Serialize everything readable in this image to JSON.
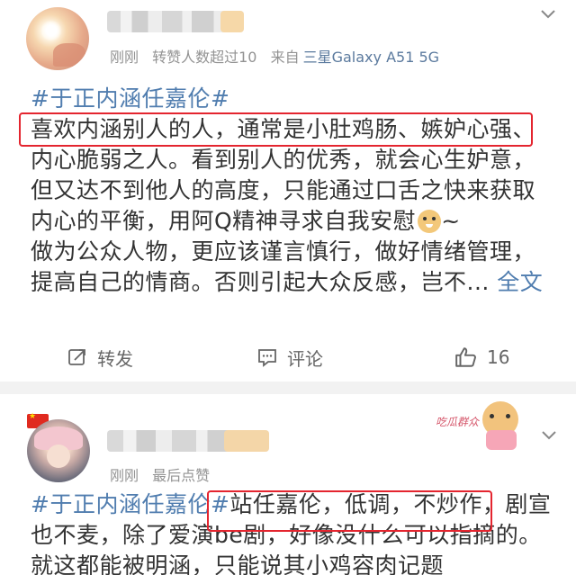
{
  "post1": {
    "time": "刚刚",
    "repost_info": "转赞人数超过10",
    "source_prefix": "来自",
    "device": "三星Galaxy A51 5G",
    "lines": [
      {
        "hashtag": "#于正内涵任嘉伦#",
        "text": ""
      },
      {
        "hashtag": "",
        "text": "喜欢内涵别人的人，通常是小肚鸡肠、嫉妒心强、"
      },
      {
        "hashtag": "",
        "text": "内心脆弱之人。看到别人的优秀，就会心生妒意，"
      },
      {
        "hashtag": "",
        "text": "但又达不到他人的高度，只能通过口舌之快来获取"
      },
      {
        "hashtag": "",
        "text": "内心的平衡，用阿Q精神寻求自我安慰"
      },
      {
        "hashtag": "",
        "text": "做为公众人物，更应该谨言慎行，做好情绪管理，"
      },
      {
        "hashtag": "",
        "text": "提高自己的情商。否则引起大众反感，岂不..."
      }
    ],
    "emoji_tail": "~",
    "full_text_link": "全文",
    "actions": {
      "repost": "转发",
      "comment": "评论",
      "like_count": "16"
    }
  },
  "post2": {
    "time": "刚刚",
    "status": "最后点赞",
    "sticker_text": "吃瓜群众",
    "line1_hashtag": "#于正内涵任嘉伦#",
    "line1_text": "站任嘉伦，低调，不炒作，剧宣",
    "line2_text": "也不麦，除了爱演be剧，好像没什么可以指摘的。",
    "line3_text": "就这都能被明涵，只能说其小鸡容肉记题"
  },
  "colors": {
    "link": "#507daf",
    "highlight_box": "#e4252f",
    "meta": "#939393",
    "separator": "#f2f2f2"
  }
}
